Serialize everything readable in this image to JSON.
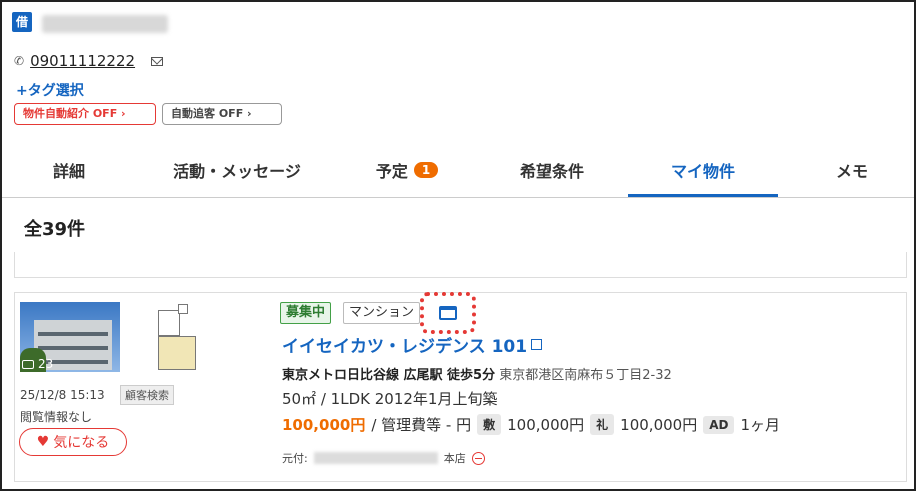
{
  "customer": {
    "icon_text": "借",
    "phone": "09011112222",
    "tag_select": "+タグ選択",
    "auto_intro": "物件自動紹介 OFF",
    "auto_followup": "自動追客 OFF"
  },
  "tabs": [
    {
      "label": "詳細"
    },
    {
      "label": "活動・メッセージ"
    },
    {
      "label": "予定",
      "count": "1"
    },
    {
      "label": "希望条件"
    },
    {
      "label": "マイ物件"
    },
    {
      "label": "メモ"
    }
  ],
  "total_label": "全39件",
  "property": {
    "photo_count": "23",
    "date": "25/12/8 15:13",
    "search_tag": "顧客検索",
    "view_info": "閲覧情報なし",
    "favorite_label": "気になる",
    "status": "募集中",
    "type": "マンション",
    "name": "イイセイカツ・レジデンス 101",
    "line_station": "東京メトロ日比谷線 広尾駅 徒歩5分",
    "address": "東京都港区南麻布５丁目2-32",
    "specs": "50㎡ / 1LDK  2012年1月上旬築",
    "price": "100,000円",
    "mgmt_fee": "/ 管理費等 - 円",
    "deposit_label": "敷",
    "deposit": "100,000円",
    "key_money_label": "礼",
    "key_money": "100,000円",
    "ad_label": "AD",
    "ad": "1ヶ月",
    "source_label": "元付:",
    "source_branch": "本店"
  },
  "colors": {
    "primary": "#1565c0",
    "orange": "#ef6c00",
    "red": "#e53935",
    "green": "#43a047"
  }
}
